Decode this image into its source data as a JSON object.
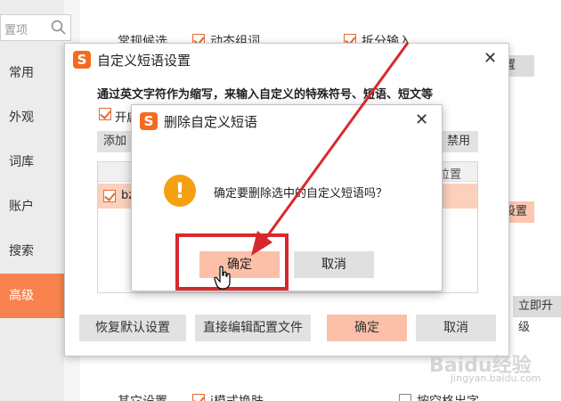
{
  "settings": {
    "search_placeholder": "置项",
    "sidebar": [
      {
        "label": "常用"
      },
      {
        "label": "外观"
      },
      {
        "label": "词库"
      },
      {
        "label": "账户"
      },
      {
        "label": "搜索"
      },
      {
        "label": "高级",
        "active": true
      }
    ],
    "section_candidate": "常规候选",
    "option_dynamic": "动态组词",
    "option_split": "拆分输入",
    "btn_settings_1": "置",
    "btn_settings_2": "设置",
    "btn_upgrade": "立即升级",
    "section_other": "其它设置",
    "option_imode": "i模式换肤",
    "option_space": "按空格出字"
  },
  "phrase_dialog": {
    "title": "自定义短语设置",
    "description": "通过英文字符作为缩写，来输入自定义的特殊符号、短语、短文等",
    "enable_label": "开启",
    "add_button": "添加",
    "disable_button": "禁用",
    "column_position": "位置",
    "row_text": "bz",
    "restore_defaults": "恢复默认设置",
    "edit_config": "直接编辑配置文件",
    "ok": "确定",
    "cancel": "取消"
  },
  "confirm_dialog": {
    "title": "删除自定义短语",
    "message": "确定要删除选中的自定义短语吗？",
    "ok": "确定",
    "cancel": "取消"
  },
  "watermark": {
    "text": "Baidu经验",
    "url": "jingyan.baidu.com"
  },
  "colors": {
    "accent": "#f7824e",
    "primary_button": "#fcc0a8",
    "highlight": "#d8282d",
    "warning": "#f5a011"
  }
}
